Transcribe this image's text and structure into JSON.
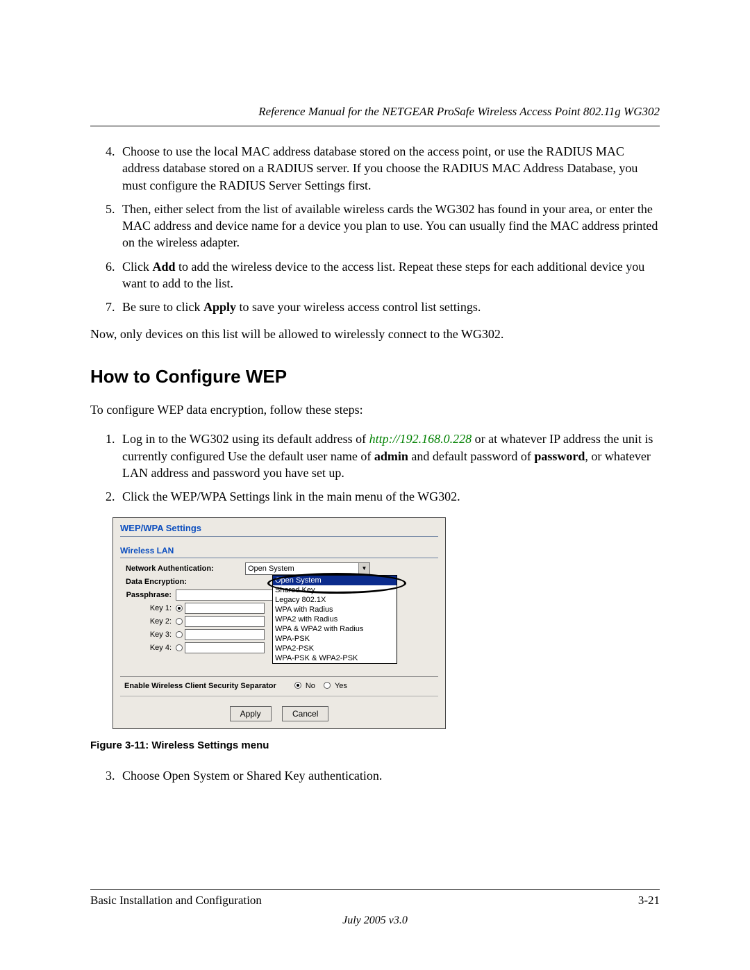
{
  "header_title": "Reference Manual for the NETGEAR ProSafe Wireless Access Point 802.11g WG302",
  "steps_a": {
    "s4": "Choose to use the local MAC address database stored on the access point, or use the RADIUS MAC address database stored on a RADIUS server. If you choose the RADIUS MAC Address Database, you must configure the RADIUS Server Settings first.",
    "s5": "Then, either select from the list of available wireless cards the WG302 has found in your area, or enter the MAC address and device name for a device you plan to use. You can usually find the MAC address printed on the wireless adapter.",
    "s6_pre": "Click ",
    "s6_b": "Add",
    "s6_post": " to add the wireless device to the access list. Repeat these steps for each additional device you want to add to the list.",
    "s7_pre": "Be sure to click ",
    "s7_b": "Apply",
    "s7_post": " to save your wireless access control list settings."
  },
  "para_after": "Now, only devices on this list will be allowed to wirelessly connect to the WG302.",
  "section_heading": "How to Configure WEP",
  "intro": "To configure WEP data encryption, follow these steps:",
  "steps_b": {
    "s1_pre": "Log in to the WG302 using its default address of ",
    "s1_link": "http://192.168.0.228",
    "s1_mid": " or at whatever IP address the unit is currently configured Use the default user name of ",
    "s1_b1": "admin",
    "s1_mid2": " and default password of ",
    "s1_b2": "password",
    "s1_post": ", or whatever LAN address and password you have set up.",
    "s2": "Click the WEP/WPA Settings link in the main menu of the WG302.",
    "s3": "Choose Open System or Shared Key authentication."
  },
  "screenshot": {
    "title": "WEP/WPA Settings",
    "subtitle": "Wireless LAN",
    "labels": {
      "netauth": "Network Authentication:",
      "dataenc": "Data Encryption:",
      "passphrase": "Passphrase:",
      "key1": "Key 1:",
      "key2": "Key 2:",
      "key3": "Key 3:",
      "key4": "Key 4:",
      "separator": "Enable Wireless Client Security Separator",
      "no": "No",
      "yes": "Yes"
    },
    "select_value": "Open System",
    "options": [
      "Open System",
      "Shared Key",
      "Legacy 802.1X",
      "WPA with Radius",
      "WPA2 with Radius",
      "WPA & WPA2 with Radius",
      "WPA-PSK",
      "WPA2-PSK",
      "WPA-PSK & WPA2-PSK"
    ],
    "buttons": {
      "apply": "Apply",
      "cancel": "Cancel"
    }
  },
  "figure_caption": "Figure 3-11:  Wireless Settings menu",
  "footer": {
    "left": "Basic Installation and Configuration",
    "right": "3-21",
    "date": "July 2005 v3.0"
  }
}
